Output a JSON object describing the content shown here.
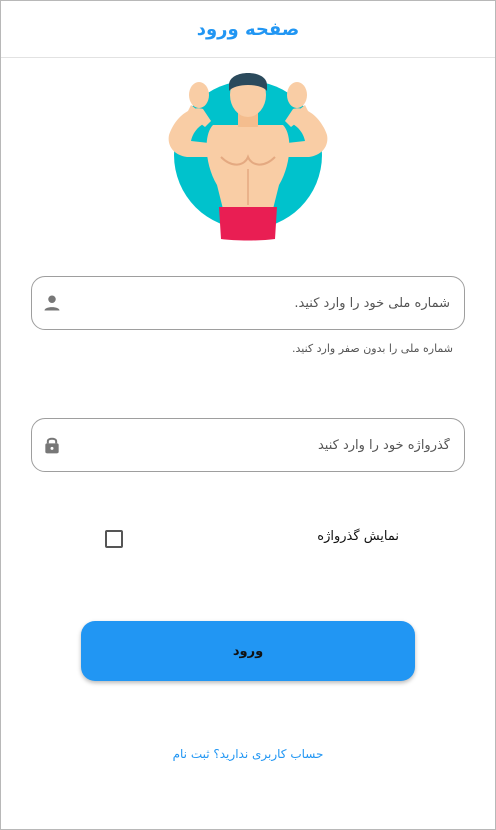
{
  "header": {
    "title": "صفحه ورود"
  },
  "logo": {
    "icon": "muscle-man-icon",
    "circle_color": "#00c2cc",
    "skin_color": "#f9cda5",
    "shorts_color": "#e91e53",
    "hair_color": "#2b4a5c"
  },
  "national_id": {
    "placeholder": "شماره ملی خود را وارد کنید.",
    "value": "",
    "icon": "person-icon",
    "helper": "شماره ملی را بدون صفر وارد کنید."
  },
  "password": {
    "placeholder": "گذرواژه خود را وارد کنید",
    "value": "",
    "icon": "lock-icon"
  },
  "show_password": {
    "label": "نمایش گذرواژه",
    "checked": false
  },
  "login_button": {
    "label": "ورود",
    "color": "#2196f3"
  },
  "signup_link": {
    "label": "حساب کاربری ندارید؟ ثبت نام",
    "color": "#2196f3"
  }
}
